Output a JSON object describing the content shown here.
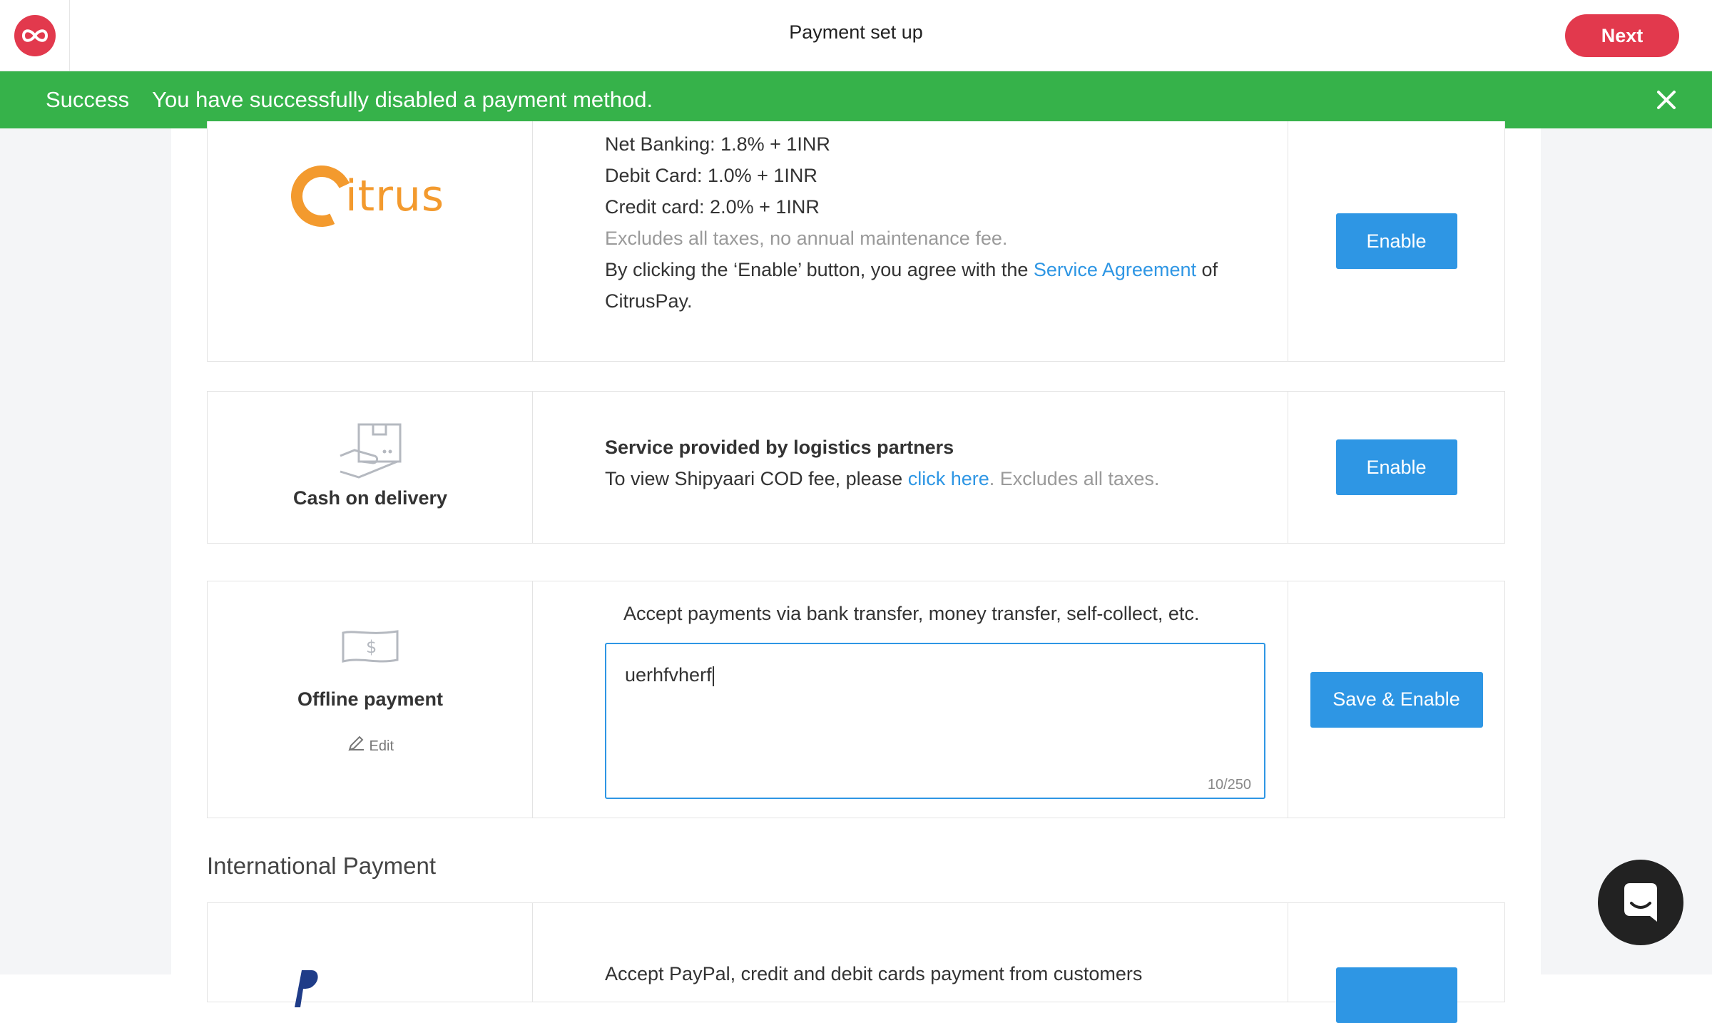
{
  "header": {
    "title": "Payment set up",
    "next_label": "Next",
    "brand_color": "#e2394d"
  },
  "banner": {
    "status": "Success",
    "message": "You have successfully disabled a payment method.",
    "color": "#36b24a"
  },
  "methods": {
    "citrus": {
      "logo_text": "itrus",
      "lines": [
        "Net Banking: 1.8% + 1INR",
        "Debit Card: 1.0% + 1INR",
        "Credit card: 2.0% + 1INR"
      ],
      "note": "Excludes all taxes, no annual maintenance fee.",
      "agreement_prefix": "By clicking the ‘Enable’ button, you agree with the ",
      "agreement_link": "Service Agreement",
      "agreement_suffix": " of",
      "agreement_tail": "CitrusPay.",
      "action_label": "Enable"
    },
    "cod": {
      "name": "Cash on delivery",
      "title": "Service provided by logistics partners",
      "sub_prefix": "To view Shipyaari COD fee, please ",
      "sub_link": "click here",
      "sub_suffix": ". Excludes all taxes.",
      "action_label": "Enable"
    },
    "offline": {
      "name": "Offline payment",
      "edit_label": "Edit",
      "caption": "Accept payments via bank transfer, money transfer, self-collect, etc.",
      "value": "uerhfvherf",
      "char_count": "10/250",
      "action_label": "Save & Enable"
    }
  },
  "international": {
    "section_title": "International Payment",
    "desc": "Accept PayPal, credit and debit cards payment from customers"
  },
  "accent_color": "#2e96e4"
}
